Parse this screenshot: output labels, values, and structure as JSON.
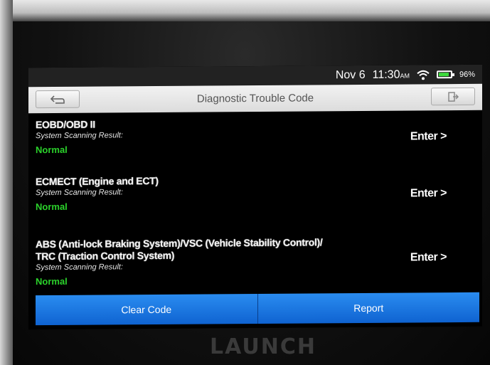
{
  "status_bar": {
    "date": "Nov 6",
    "time": "11:30",
    "ampm": "AM",
    "battery": "96%"
  },
  "header": {
    "title": "Diagnostic Trouble Code",
    "back_icon": "back-arrow-icon",
    "exit_icon": "exit-icon"
  },
  "systems": [
    {
      "name": "EOBD/OBD II",
      "name_line2": "",
      "label": "System Scanning Result:",
      "result": "Normal",
      "enter": "Enter >"
    },
    {
      "name": "ECMECT (Engine and ECT)",
      "name_line2": "",
      "label": "System Scanning Result:",
      "result": "Normal",
      "enter": "Enter >"
    },
    {
      "name": "ABS (Anti-lock Braking System)/VSC (Vehicle Stability Control)/",
      "name_line2": "TRC (Traction Control System)",
      "label": "System Scanning Result:",
      "result": "Normal",
      "enter": "Enter >"
    }
  ],
  "footer": {
    "clear_code": "Clear Code",
    "report": "Report"
  },
  "brand": "LAUNCH",
  "colors": {
    "accent": "#1a73e8",
    "normal_status": "#2bd22b",
    "title_bar": "#e6e6e6"
  }
}
